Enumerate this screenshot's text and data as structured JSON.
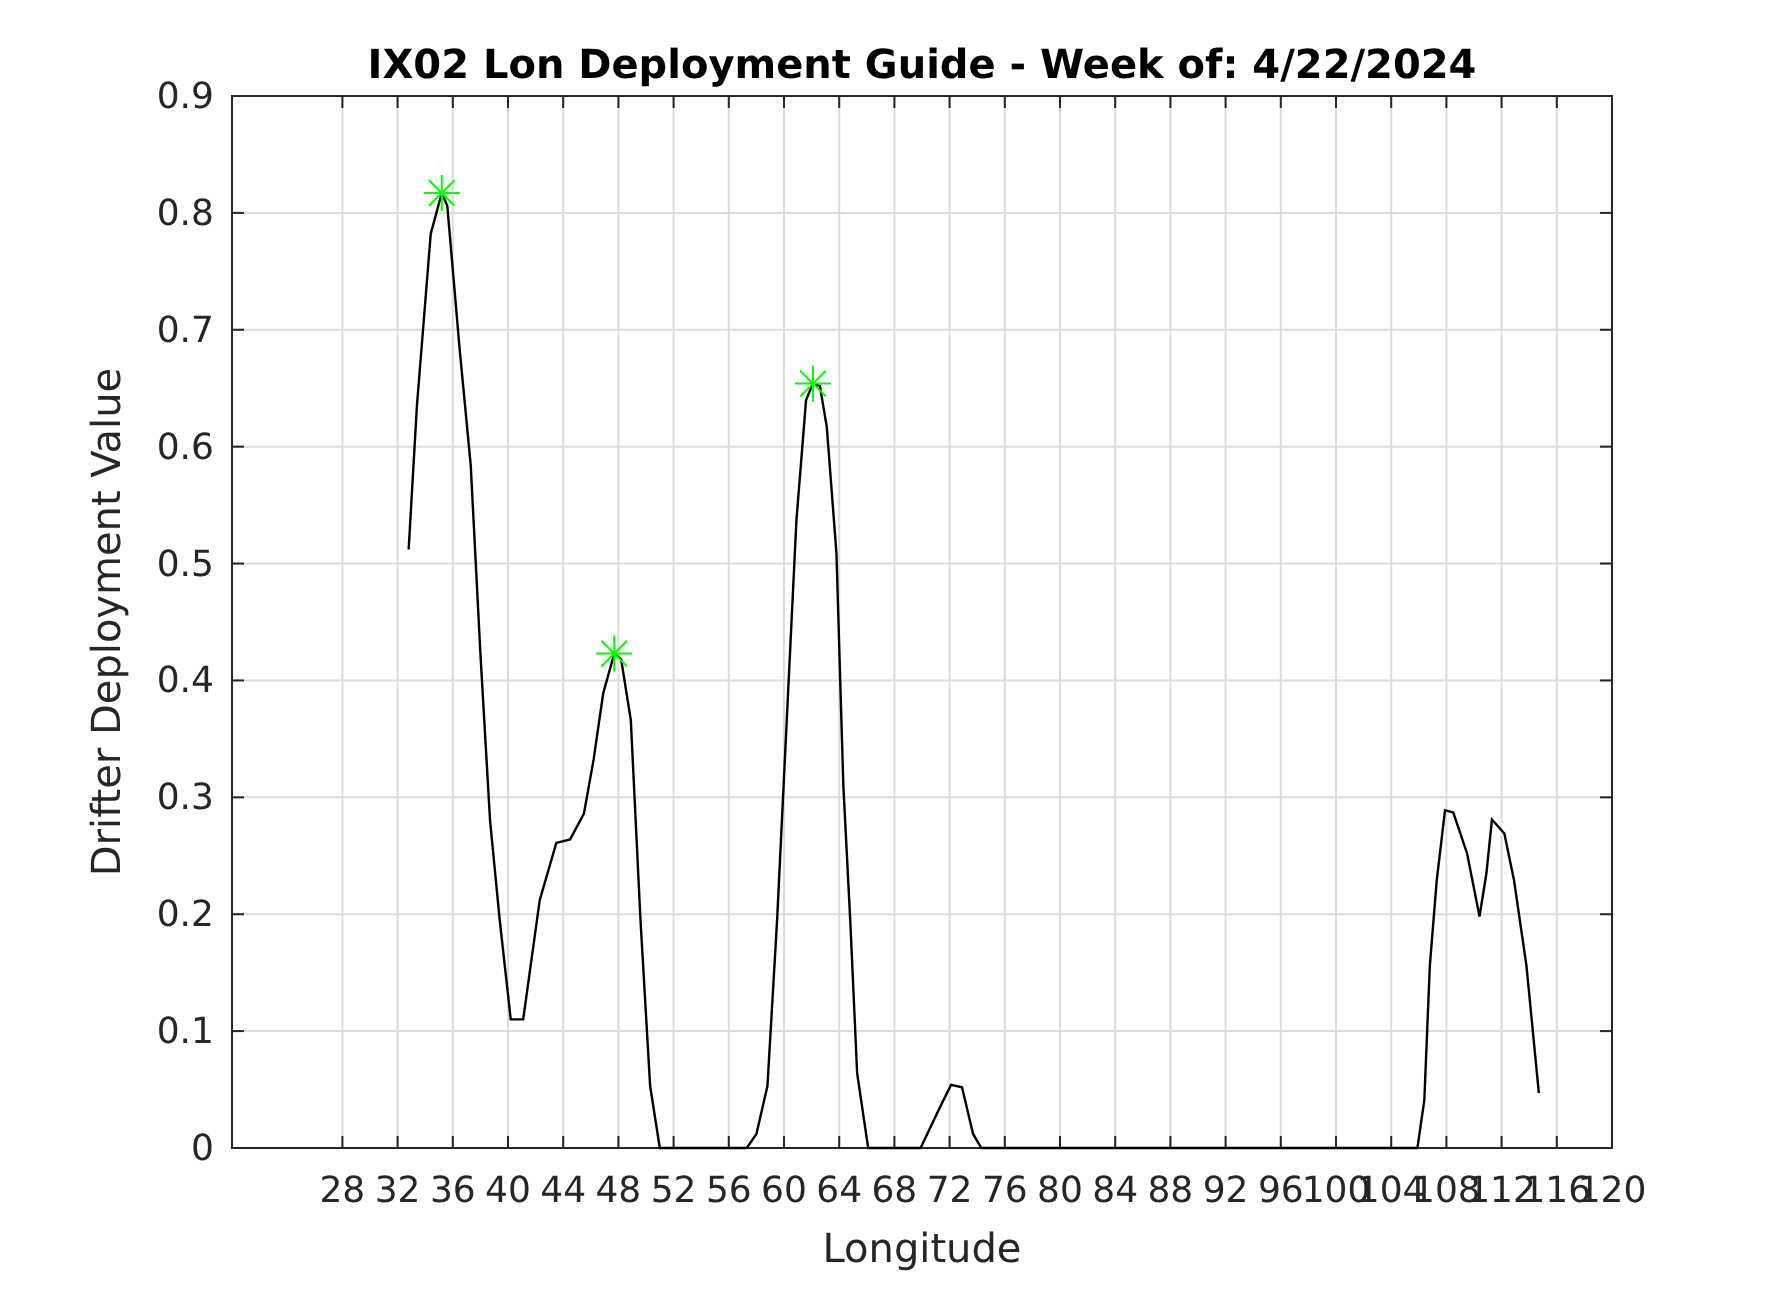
{
  "chart_data": {
    "type": "line",
    "title": "IX02 Lon Deployment Guide - Week of: 4/22/2024",
    "xlabel": "Longitude",
    "ylabel": "Drifter Deployment Value",
    "xlim": [
      20,
      120
    ],
    "ylim": [
      0,
      0.9
    ],
    "xticks": [
      28,
      32,
      36,
      40,
      44,
      48,
      52,
      56,
      60,
      64,
      68,
      72,
      76,
      80,
      84,
      88,
      92,
      96,
      100,
      104,
      108,
      112,
      116,
      120
    ],
    "yticks": [
      0,
      0.1,
      0.2,
      0.3,
      0.4,
      0.5,
      0.6,
      0.7,
      0.8,
      0.9
    ],
    "x": [
      32.8,
      33.4,
      34.4,
      35.2,
      35.6,
      36.5,
      37.3,
      38.0,
      38.7,
      39.4,
      40.2,
      41.1,
      42.3,
      43.5,
      44.5,
      45.5,
      46.2,
      46.9,
      47.7,
      48.2,
      48.9,
      49.6,
      50.3,
      51.0,
      57.3,
      58.0,
      58.8,
      59.5,
      60.2,
      60.9,
      61.6,
      62.1,
      62.6,
      63.1,
      63.8,
      64.3,
      64.8,
      65.3,
      66.1,
      69.9,
      71.1,
      72.1,
      72.9,
      73.7,
      74.3,
      105.9,
      106.4,
      106.8,
      107.3,
      107.9,
      108.5,
      109.5,
      110.4,
      110.9,
      111.3,
      112.2,
      112.9,
      113.8,
      114.7
    ],
    "series": [
      {
        "color": "#000000",
        "values": [
          0.512,
          0.635,
          0.782,
          0.817,
          0.806,
          0.683,
          0.584,
          0.423,
          0.28,
          0.195,
          0.11,
          0.11,
          0.212,
          0.261,
          0.264,
          0.286,
          0.332,
          0.389,
          0.423,
          0.418,
          0.366,
          0.195,
          0.053,
          0,
          0,
          0.012,
          0.053,
          0.195,
          0.366,
          0.537,
          0.64,
          0.654,
          0.652,
          0.617,
          0.509,
          0.31,
          0.195,
          0.064,
          0,
          0,
          0.03,
          0.054,
          0.052,
          0.012,
          0,
          0,
          0.041,
          0.156,
          0.229,
          0.289,
          0.287,
          0.252,
          0.198,
          0.235,
          0.281,
          0.269,
          0.229,
          0.156,
          0.047
        ]
      },
      {
        "color": "#00ff00",
        "marker": "cross",
        "values": [
          null,
          null,
          null,
          0.817,
          null,
          null,
          null,
          null,
          null,
          null,
          null,
          null,
          null,
          null,
          null,
          null,
          null,
          null,
          0.423,
          null,
          null,
          null,
          null,
          null,
          null,
          null,
          null,
          null,
          null,
          null,
          null,
          0.654,
          null,
          null,
          null,
          null,
          null,
          null,
          null,
          null,
          null,
          null,
          null,
          null,
          null,
          null,
          null,
          null,
          null,
          null,
          null,
          null,
          null,
          null,
          null,
          null,
          null,
          null,
          null
        ]
      }
    ],
    "grid": true
  }
}
